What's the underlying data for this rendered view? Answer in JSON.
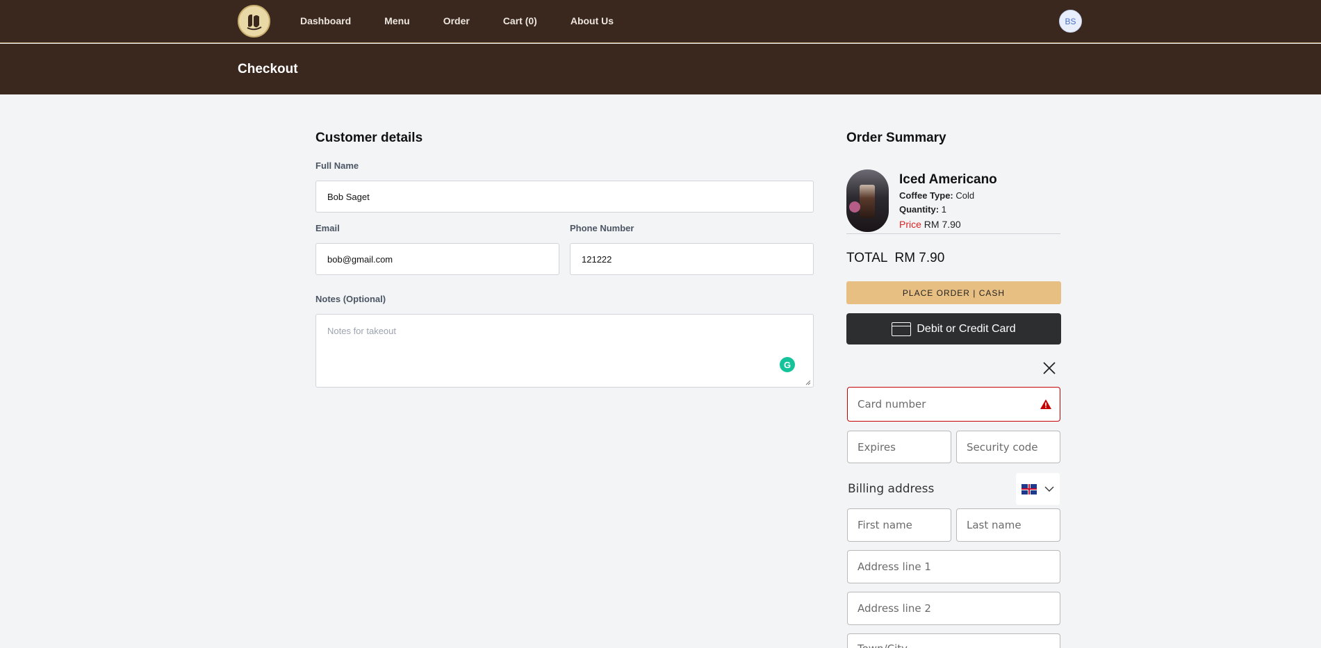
{
  "nav": {
    "items": [
      "Dashboard",
      "Menu",
      "Order",
      "Cart (0)",
      "About Us"
    ],
    "avatar_initials": "BS"
  },
  "page": {
    "title": "Checkout"
  },
  "customer": {
    "heading": "Customer details",
    "full_name_label": "Full Name",
    "full_name_value": "Bob Saget",
    "email_label": "Email",
    "email_value": "bob@gmail.com",
    "phone_label": "Phone Number",
    "phone_value": "121222",
    "notes_label": "Notes (Optional)",
    "notes_placeholder": "Notes for takeout"
  },
  "summary": {
    "heading": "Order Summary",
    "item": {
      "name": "Iced Americano",
      "type_label": "Coffee Type:",
      "type_value": "Cold",
      "qty_label": "Quantity:",
      "qty_value": "1",
      "price_label": "Price",
      "price_value": "RM 7.90"
    },
    "total_label": "TOTAL",
    "total_value": "RM 7.90",
    "cash_button": "PLACE ORDER | CASH",
    "card_button": "Debit or Credit Card"
  },
  "payment_form": {
    "card_number": "Card number",
    "expires": "Expires",
    "security_code": "Security code",
    "billing_address": "Billing address",
    "first_name": "First name",
    "last_name": "Last name",
    "address1": "Address line 1",
    "address2": "Address line 2",
    "town_city": "Town/City"
  }
}
